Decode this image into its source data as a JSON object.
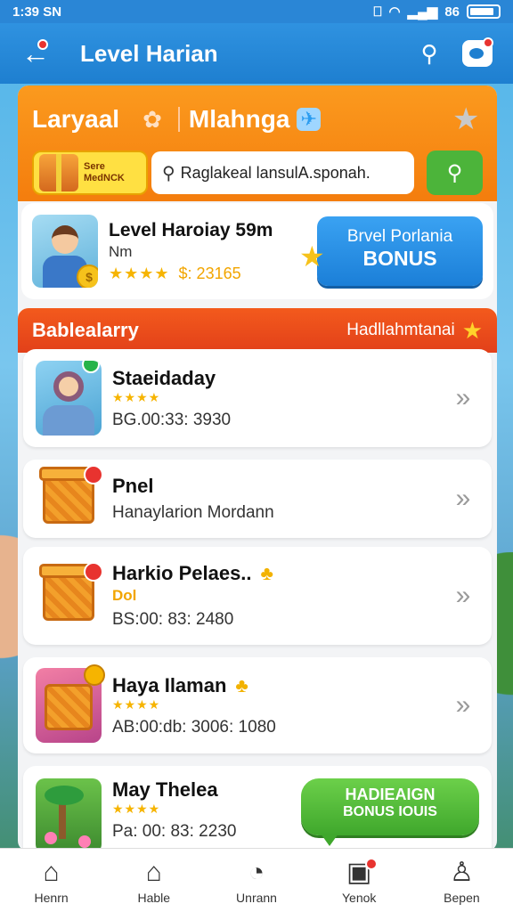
{
  "status_bar": {
    "time": "1:39 SN",
    "battery": "86"
  },
  "header": {
    "title": "Level Harian"
  },
  "top_tabs": {
    "tab1": "Laryaal",
    "tab2": "Mlahnga"
  },
  "gift_chip": {
    "line1": "Sere",
    "line2": "MedNCK"
  },
  "search": {
    "placeholder": "Raglakeal lansulA.sponah."
  },
  "featured": {
    "title": "Level Haroiay 59m",
    "subtitle": "Nm",
    "stars": "★★★★",
    "price": "$: 23165",
    "bonus_line1": "Brvel Porlania",
    "bonus_line2": "BONUS"
  },
  "section": {
    "title": "Bablealarry",
    "right_label": "Hadllahmtanai"
  },
  "items": [
    {
      "title": "Staeidaday",
      "stars": "★★★★",
      "sub": "BG.00:33: 3930"
    },
    {
      "title": "Pnel",
      "sub": "Hanaylarion Mordann"
    },
    {
      "title": "Harkio Pelaes..",
      "tag": "Dol",
      "sub": "BS:00: 83: 2480"
    },
    {
      "title": "Haya Ilaman",
      "stars": "★★★★",
      "sub": "AB:00:db: 3006: 1080"
    },
    {
      "title": "May Thelea",
      "stars": "★★★★",
      "sub": "Pa: 00: 83: 2230"
    }
  ],
  "campaign": {
    "line1": "HADIEAIGN",
    "line2": "BONUS IOUIS"
  },
  "bottom_nav": [
    {
      "label": "Henrn",
      "icon": "home-icon"
    },
    {
      "label": "Hable",
      "icon": "house-icon"
    },
    {
      "label": "Unrann",
      "icon": "clock-icon"
    },
    {
      "label": "Yenok",
      "icon": "note-icon"
    },
    {
      "label": "Bepen",
      "icon": "profile-icon"
    }
  ],
  "colors": {
    "header_blue": "#1e7fd0",
    "orange": "#f47d0d",
    "section_red": "#e2401a",
    "bonus_blue": "#1b7fd8",
    "green": "#3fa72c"
  }
}
